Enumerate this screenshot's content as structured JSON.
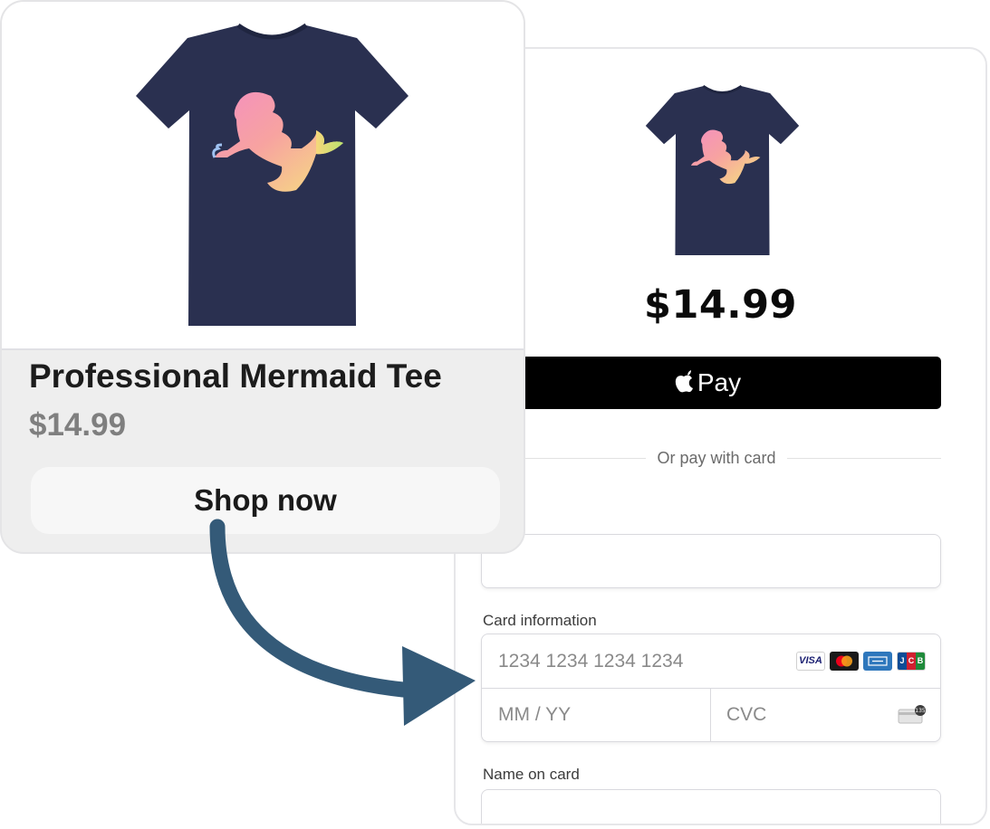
{
  "product_card": {
    "title": "Professional Mermaid Tee",
    "price": "$14.99",
    "shop_button_label": "Shop now"
  },
  "checkout": {
    "price": "$14.99",
    "apple_pay_label": "Pay",
    "divider_text": "Or pay with card",
    "card_information_label": "Card information",
    "card_number_placeholder": "1234 1234 1234 1234",
    "expiry_placeholder": "MM / YY",
    "cvc_placeholder": "CVC",
    "name_on_card_label": "Name on card",
    "card_brands": [
      "visa-icon",
      "mastercard-icon",
      "amex-icon",
      "jcb-icon"
    ],
    "brand_visa_text": "VISA"
  },
  "colors": {
    "shirt_navy": "#2a3050",
    "arrow": "#345a78",
    "apple_pay_bg": "#000000",
    "product_card_bg": "#eeeeee"
  },
  "icons": [
    "apple-logo-icon",
    "cvc-card-icon",
    "flow-arrow-icon"
  ]
}
